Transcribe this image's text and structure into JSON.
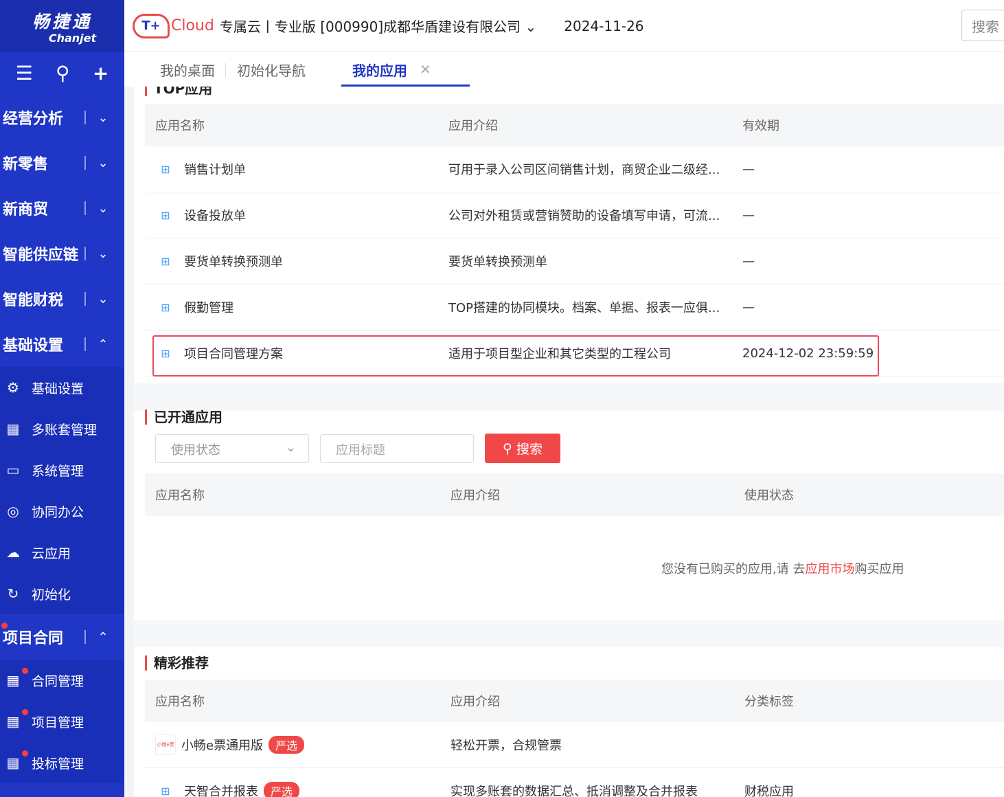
{
  "brand": {
    "name_cn": "畅捷通",
    "name_en": "Chanjet"
  },
  "sidebar_tools": {
    "menu_icon": "☰",
    "search_icon": "⚲",
    "add_icon": "+"
  },
  "sidebar": {
    "groups": [
      {
        "label": "经营分析",
        "chevron": "⌄"
      },
      {
        "label": "新零售",
        "chevron": "⌄"
      },
      {
        "label": "新商贸",
        "chevron": "⌄"
      },
      {
        "label": "智能供应链",
        "chevron": "⌄"
      },
      {
        "label": "智能财税",
        "chevron": "⌄"
      },
      {
        "label": "基础设置",
        "chevron": "⌃"
      }
    ],
    "basic_sub": [
      {
        "label": "基础设置",
        "icon": "⚙"
      },
      {
        "label": "多账套管理",
        "icon": "▦"
      },
      {
        "label": "系统管理",
        "icon": "▭"
      },
      {
        "label": "协同办公",
        "icon": "◎"
      },
      {
        "label": "云应用",
        "icon": "☁"
      },
      {
        "label": "初始化",
        "icon": "↻"
      }
    ],
    "project_group": {
      "label": "项目合同",
      "chevron": "⌃"
    },
    "project_sub": [
      {
        "label": "合同管理",
        "icon": "▦"
      },
      {
        "label": "项目管理",
        "icon": "▦"
      },
      {
        "label": "投标管理",
        "icon": "▦"
      }
    ]
  },
  "topbar": {
    "cloud_mark": "T+",
    "cloud_word": "Cloud",
    "company": "专属云丨专业版 [000990]成都华盾建设有限公司 ⌄",
    "date": "2024-11-26",
    "search_placeholder": "搜索"
  },
  "tabs": [
    {
      "label": "我的桌面"
    },
    {
      "label": "初始化导航"
    },
    {
      "label": "我的应用",
      "close": "✕"
    }
  ],
  "top_apps": {
    "title": "TOP应用",
    "headers": [
      "应用名称",
      "应用介绍",
      "有效期"
    ],
    "rows": [
      {
        "name": "销售计划单",
        "desc": "可用于录入公司区间销售计划，商贸企业二级经...",
        "valid": "—"
      },
      {
        "name": "设备投放单",
        "desc": "公司对外租赁或营销赞助的设备填写申请，可流...",
        "valid": "—"
      },
      {
        "name": "要货单转换预测单",
        "desc": "要货单转换预测单",
        "valid": "—"
      },
      {
        "name": "假勤管理",
        "desc": "TOP搭建的协同模块。档案、单据、报表一应俱...",
        "valid": "—"
      },
      {
        "name": "项目合同管理方案",
        "desc": "适用于项目型企业和其它类型的工程公司",
        "valid": "2024-12-02 23:59:59"
      }
    ]
  },
  "opened_apps": {
    "title": "已开通应用",
    "status_placeholder": "使用状态",
    "status_arrow": "⌄",
    "title_placeholder": "应用标题",
    "search_label": "搜索",
    "search_icon": "⚲",
    "headers": [
      "应用名称",
      "应用介绍",
      "使用状态"
    ],
    "empty_prefix": "您没有已购买的应用,请 去",
    "empty_link": "应用市场",
    "empty_suffix": "购买应用"
  },
  "recommend": {
    "title": "精彩推荐",
    "headers": [
      "应用名称",
      "应用介绍",
      "分类标签"
    ],
    "rows": [
      {
        "name": "小畅e票通用版",
        "badge": "严选",
        "logo": "小畅e票",
        "desc": "轻松开票，合规管票",
        "tag": ""
      },
      {
        "name": "天智合并报表",
        "badge": "严选",
        "desc": "实现多账套的数据汇总、抵消调整及合并报表",
        "tag": "财税应用"
      }
    ]
  }
}
